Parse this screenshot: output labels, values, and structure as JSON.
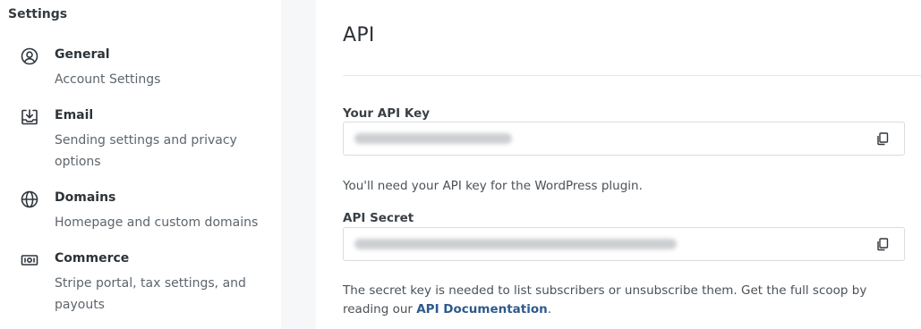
{
  "sidebar": {
    "title": "Settings",
    "items": [
      {
        "icon": "user-circle-icon",
        "label": "General",
        "description": "Account Settings"
      },
      {
        "icon": "inbox-download-icon",
        "label": "Email",
        "description": "Sending settings and privacy options"
      },
      {
        "icon": "globe-icon",
        "label": "Domains",
        "description": "Homepage and custom domains"
      },
      {
        "icon": "banknote-icon",
        "label": "Commerce",
        "description": "Stripe portal, tax settings, and payouts"
      }
    ]
  },
  "main": {
    "title": "API",
    "api_key": {
      "label": "Your API Key",
      "value": "",
      "copy_icon": "copy-icon",
      "help": "You'll need your API key for the WordPress plugin."
    },
    "api_secret": {
      "label": "API Secret",
      "value": "",
      "copy_icon": "copy-icon",
      "help_prefix": "The secret key is needed to list subscribers or unsubscribe them. Get the full scoop by reading our ",
      "help_link": "API Documentation",
      "help_suffix": "."
    }
  },
  "colors": {
    "gutter": "#f6f7f8",
    "link": "#2d5a8c",
    "border": "#d8dce0"
  }
}
